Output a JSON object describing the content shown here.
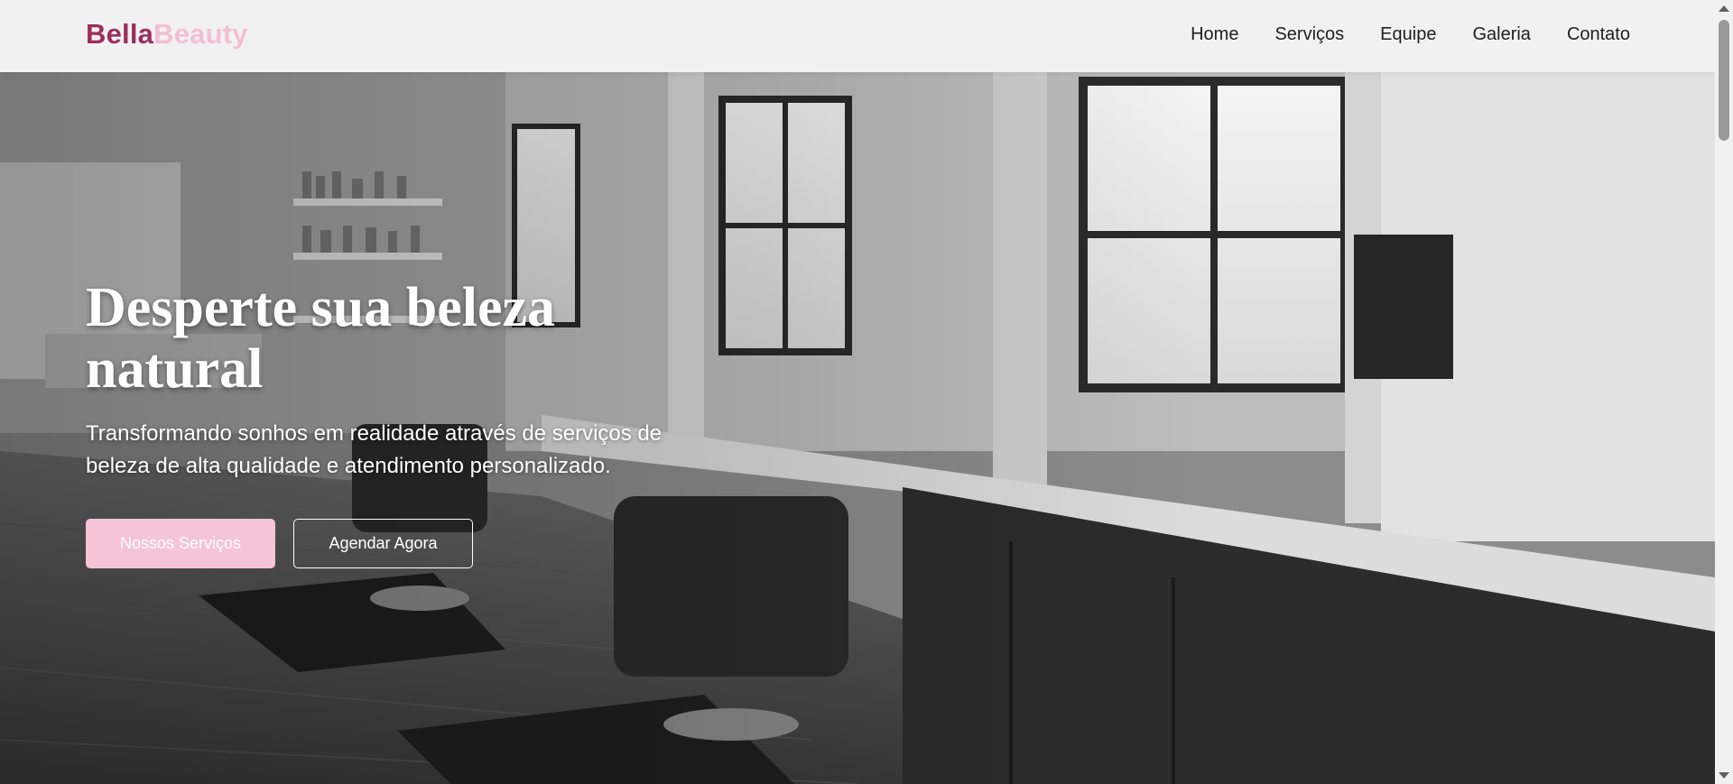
{
  "brand": {
    "part1": "Bella",
    "part2": "Beauty"
  },
  "nav": {
    "items": [
      {
        "label": "Home"
      },
      {
        "label": "Serviços"
      },
      {
        "label": "Equipe"
      },
      {
        "label": "Galeria"
      },
      {
        "label": "Contato"
      }
    ]
  },
  "hero": {
    "title": "Desperte sua beleza natural",
    "subtitle": "Transformando sonhos em realidade através de serviços de beleza de alta qualidade e atendimento personalizado.",
    "primary_button": "Nossos Serviços",
    "secondary_button": "Agendar Agora"
  },
  "colors": {
    "brand_dark": "#9b2e5e",
    "brand_light": "#f2bfd2",
    "button_pink": "#f5c4d6"
  }
}
